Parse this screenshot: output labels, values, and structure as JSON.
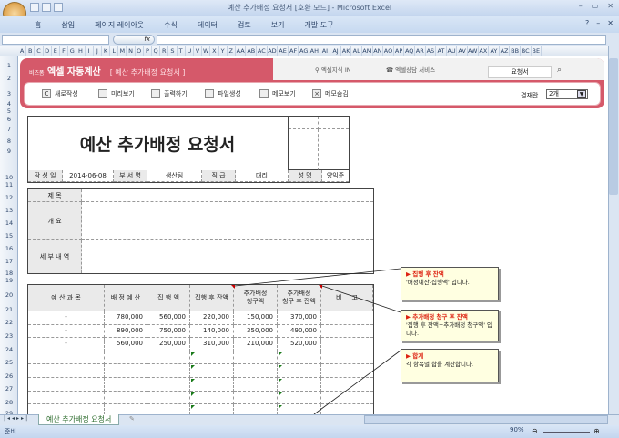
{
  "window": {
    "title": "예산 추가배정 요청서  [호환 모드] - Microsoft Excel",
    "controls": [
      "–",
      "▭",
      "✕"
    ]
  },
  "ribbon": {
    "tabs": [
      "홈",
      "삽입",
      "페이지 레이아웃",
      "수식",
      "데이터",
      "검토",
      "보기",
      "개발 도구"
    ],
    "help": "?"
  },
  "formula": {
    "fx": "fx",
    "namebox": "",
    "value": ""
  },
  "columns": [
    "A",
    "B",
    "C",
    "D",
    "E",
    "F",
    "G",
    "H",
    "I",
    "J",
    "K",
    "L",
    "M",
    "N",
    "O",
    "P",
    "Q",
    "R",
    "S",
    "T",
    "U",
    "V",
    "W",
    "X",
    "Y",
    "Z",
    "AA",
    "AB",
    "AC",
    "AD",
    "AE",
    "AF",
    "AG",
    "AH",
    "AI",
    "AJ",
    "AK",
    "AL",
    "AM",
    "AN",
    "AO",
    "AP",
    "AQ",
    "AR",
    "AS",
    "AT",
    "AU",
    "AV",
    "AW",
    "AX",
    "AY",
    "AZ",
    "BB",
    "BC",
    "BE"
  ],
  "banner": {
    "brand": "비즈폼",
    "title": "엑셀 자동계산",
    "subtitle": "[ 예산 추가배정 요청서 ]",
    "link1": "엑셀지식 IN",
    "link2": "엑셀상담 서비스",
    "search": "요청서"
  },
  "toolbar": {
    "buttons": [
      "새로작성",
      "미리보기",
      "출력하기",
      "파일생성",
      "메모보기",
      "메모숨김"
    ],
    "approval_label": "결재란",
    "approval_value": "2개"
  },
  "doc": {
    "title": "예산 추가배정 요청서",
    "info": {
      "date_label": "작 성 일",
      "date": "2014-06-08",
      "dept_label": "부 서 명",
      "dept": "생산팀",
      "rank_label": "직   급",
      "rank": "대리",
      "name_label": "성   명",
      "name": "양익준"
    },
    "section": {
      "subject": "제       목",
      "overview": "개       요",
      "details": "세 부 내 역"
    }
  },
  "table": {
    "headers": [
      "예 산 과 목",
      "배 정 예 산",
      "집 행 액",
      "집행 후 잔액",
      "추가배정\n청구액",
      "추가배정\n청구 후 잔액",
      "비     고"
    ],
    "rows": [
      [
        "-",
        "780,000",
        "560,000",
        "220,000",
        "150,000",
        "370,000",
        ""
      ],
      [
        "-",
        "890,000",
        "750,000",
        "140,000",
        "350,000",
        "490,000",
        ""
      ],
      [
        "-",
        "560,000",
        "250,000",
        "310,000",
        "210,000",
        "520,000",
        ""
      ]
    ]
  },
  "notes": [
    {
      "title": "▶ 집행 후 잔액",
      "body": "'배정예산-집행액' 입니다."
    },
    {
      "title": "▶ 추가배정 청구 후 잔액",
      "body": "'집행 후 잔액+추가배정 청구액' 입니다."
    },
    {
      "title": "▶ 합계",
      "body": "각 항목별 합을 계산합니다."
    }
  ],
  "sheet_tab": "예산 추가배정 요청서",
  "status": {
    "ready": "준비",
    "zoom": "90%"
  }
}
